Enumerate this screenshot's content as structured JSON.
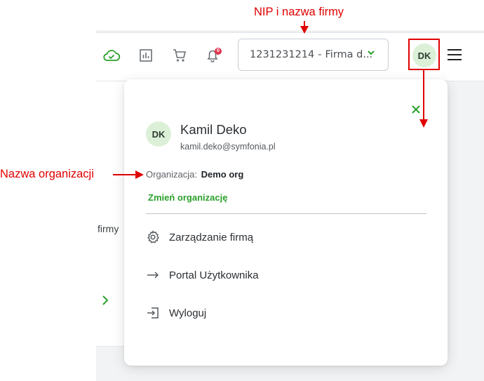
{
  "annotations": {
    "top_label": "NIP i nazwa firmy",
    "left_label": "Nazwa organizacji"
  },
  "header": {
    "company_selector": {
      "nip": "1231231214",
      "separator": "-",
      "name": "Firma d..."
    },
    "avatar_initials": "DK",
    "notification_count": "0"
  },
  "background": {
    "side_text": "firmy"
  },
  "user_menu": {
    "initials": "DK",
    "name": "Kamil Deko",
    "email": "kamil.deko@symfonia.pl",
    "organization_label": "Organizacja:",
    "organization_value": "Demo org",
    "change_org_label": "Zmień organizację",
    "items": [
      {
        "label": "Zarządzanie firmą",
        "icon": "gear-icon"
      },
      {
        "label": "Portal Użytkownika",
        "icon": "arrow-right-icon"
      },
      {
        "label": "Wyloguj",
        "icon": "logout-icon"
      }
    ]
  },
  "colors": {
    "accent_green": "#2ba02b",
    "annotation_red": "#e00000",
    "avatar_bg": "#dcf0d8"
  }
}
